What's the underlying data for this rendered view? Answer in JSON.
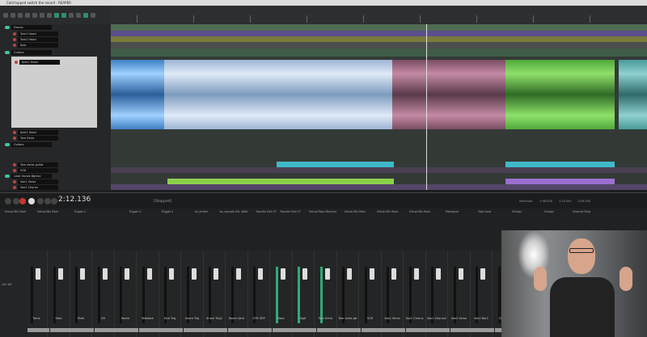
{
  "window": {
    "title": "Cold topped switch the record - REAPER"
  },
  "tracks": [
    {
      "name": "Drums",
      "type": "folder",
      "color": "#4f6b52"
    },
    {
      "name": "Tom1 Head",
      "color": "#5a4f8c"
    },
    {
      "name": "Tom2 Head",
      "color": "#7a7a3a"
    },
    {
      "name": "Kyle",
      "color": "#4a4e4c"
    },
    {
      "name": "Guitars",
      "type": "folder",
      "color": "#3f5d46"
    },
    {
      "name": "Kyle1 Head",
      "color": "#7fb2e8"
    },
    {
      "name": "Kyle1 Head",
      "color": "#3d4a44"
    },
    {
      "name": "Tom Extra",
      "color": "#3d4a44"
    },
    {
      "name": "Guitars",
      "type": "folder",
      "color": "#343d38"
    },
    {
      "name": "Tom extra guitar",
      "color": "#3fb9c9"
    },
    {
      "name": "VOX",
      "color": "#4a3f50"
    },
    {
      "name": "Lead Vocals Bgtrax",
      "type": "folder",
      "color": "#3d4a44"
    },
    {
      "name": "Vox1 Verse",
      "color": "#8bd04a"
    },
    {
      "name": "Vox2 Chorus",
      "color": "#6a4f8c"
    }
  ],
  "transport": {
    "time": "2:12.136",
    "status": "[Stopped]",
    "selection_label": "Selection:",
    "sel_start": "1:58.000",
    "sel_end": "2:24.550",
    "sel_len": "0:26.550"
  },
  "fx": [
    "Virtual Mix Rack",
    "Virtual Mix Rack",
    "Trigger 2",
    "Trigger 2",
    "Trigger 2",
    "bx_limiter",
    "bx_console SSL 4000",
    "Transfer Bell VT",
    "Transfer Bell VT",
    "Virtual Tape Machine",
    "Virtual Mix Rack",
    "Virtual Mix Rack",
    "Virtual Mix Rack",
    "Melodyne",
    "Tube Amp",
    "Scheps",
    "Scheps",
    "Channel Strip"
  ],
  "mixer": {
    "channels": [
      "Toms",
      "Hats",
      "Ride",
      "OH",
      "Room",
      "Talkback",
      "Kick Trig",
      "Snare Trig",
      "Snare Trig2",
      "Room Verb",
      "GTR GRP",
      "Bass",
      "Bgtr",
      "Tom Extra",
      "Tom extra gtr",
      "VOX",
      "Vox1 Verse",
      "Vox1 Chorus",
      "Vox1 Chorus2",
      "Vox2 Verse",
      "Vox2 Bar2",
      "CRTML"
    ],
    "master_db": [
      "-inf",
      "-inf"
    ]
  },
  "colors": {
    "accent": "#3ec79a",
    "record": "#c0392b"
  }
}
